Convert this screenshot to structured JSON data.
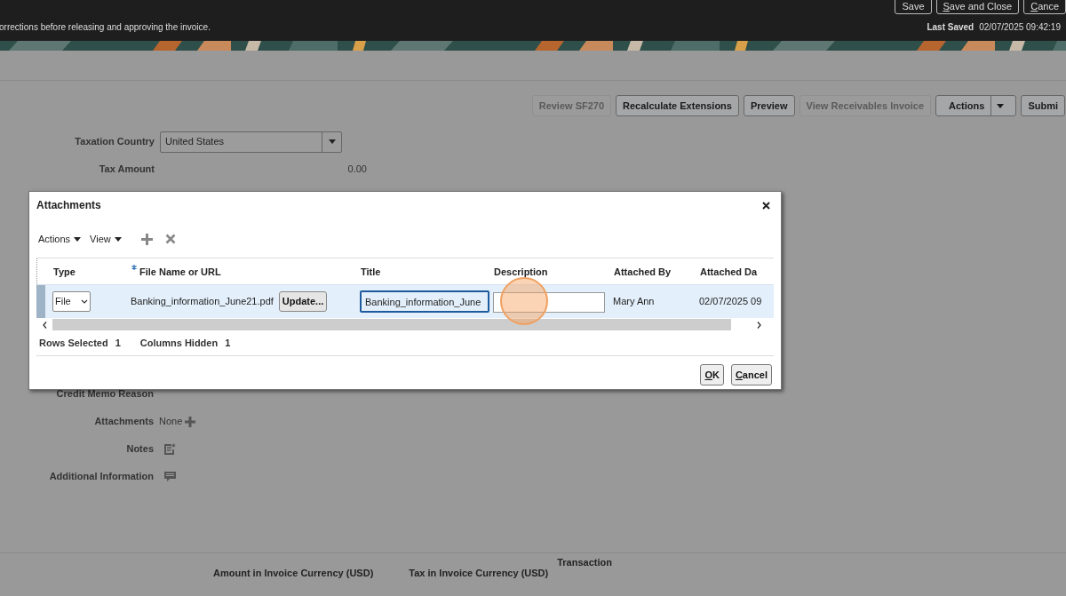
{
  "header": {
    "buttons": [
      {
        "label": "Save",
        "mnemonic": false
      },
      {
        "label": "Save and Close",
        "mnemonic": true
      },
      {
        "label": "Cance",
        "mnemonic": true
      }
    ],
    "message": "orrections before releasing and approving the invoice.",
    "last_saved_label": "Last Saved",
    "last_saved_value": "02/07/2025 09:42:19"
  },
  "toolbar": [
    {
      "kind": "button",
      "label": "Review SF270",
      "disabled": true
    },
    {
      "kind": "button",
      "label": "Recalculate Extensions",
      "disabled": false
    },
    {
      "kind": "button",
      "label": "Preview",
      "disabled": false
    },
    {
      "kind": "button",
      "label": "View Receivables Invoice",
      "disabled": true
    },
    {
      "kind": "split",
      "label": "Actions",
      "disabled": false
    },
    {
      "kind": "button",
      "label": "Submi",
      "disabled": false
    }
  ],
  "form_top": [
    {
      "kind": "select",
      "label": "Taxation Country",
      "value": "United States"
    },
    {
      "kind": "amount",
      "label": "Tax Amount",
      "value": "0.00"
    }
  ],
  "form_bottom": [
    {
      "kind": "text",
      "label": "Credit Memo Reason"
    },
    {
      "kind": "attachments",
      "label": "Attachments",
      "value": "None"
    },
    {
      "kind": "notes",
      "label": "Notes"
    },
    {
      "kind": "info",
      "label": "Additional Information"
    }
  ],
  "lines_header": [
    "Amount in Invoice Currency (USD)",
    "Tax in Invoice Currency (USD)",
    "Transaction"
  ],
  "dialog": {
    "title": "Attachments",
    "menus": [
      "Actions",
      "View"
    ],
    "columns": [
      {
        "label": "Type",
        "required": false
      },
      {
        "label": "File Name or URL",
        "required": true
      },
      {
        "label": "Title",
        "required": false
      },
      {
        "label": "Description",
        "required": false
      },
      {
        "label": "Attached By",
        "required": false
      },
      {
        "label": "Attached Da",
        "required": false
      }
    ],
    "rows": [
      {
        "selected": true,
        "type": "File",
        "file_name": "Banking_information_June21.pdf",
        "update_button": "Update...",
        "title": "Banking_information_June",
        "description": "",
        "attached_by": "Mary Ann",
        "attached_date": "02/07/2025 09"
      }
    ],
    "status": [
      {
        "label": "Rows Selected",
        "value": "1"
      },
      {
        "label": "Columns Hidden",
        "value": "1"
      }
    ],
    "buttons": [
      {
        "label": "OK",
        "mnemonic": true
      },
      {
        "label": "Cancel",
        "mnemonic": true
      }
    ]
  }
}
